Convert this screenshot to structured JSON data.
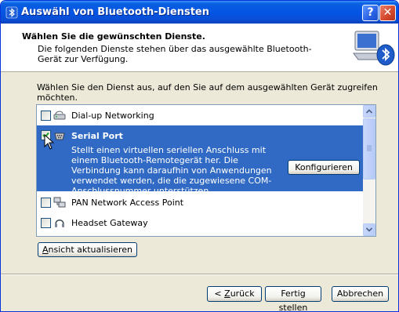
{
  "window": {
    "title": "Auswähl von Bluetooth-Diensten",
    "help_glyph": "?",
    "close_glyph": "✕"
  },
  "header": {
    "title": "Wählen Sie die gewünschten Dienste.",
    "subtitle": "Die folgenden Dienste stehen über das ausgewählte Bluetooth-Gerät zur Verfügung."
  },
  "instruction": "Wählen Sie den Dienst aus, auf den Sie auf dem ausgewählten Gerät zugreifen möchten.",
  "services": [
    {
      "label": "Dial-up Networking",
      "checked": false,
      "icon": "modem-icon"
    },
    {
      "label": "Serial Port",
      "checked": true,
      "icon": "serial-port-icon",
      "description": "Stellt einen virtuellen seriellen Anschluss mit einem Bluetooth-Remotegerät her. Die Verbindung kann daraufhin von Anwendungen verwendet werden, die die zugewiesene COM-Anschlussnummer unterstützen.",
      "configure_label": "Konfigurieren"
    },
    {
      "label": "PAN Network Access Point",
      "checked": false,
      "icon": "network-icon"
    },
    {
      "label": "Headset Gateway",
      "checked": false,
      "icon": "headset-icon"
    }
  ],
  "buttons": {
    "refresh_accel": "A",
    "refresh_rest": "nsicht aktualisieren",
    "back_prefix": "< ",
    "back_accel": "Z",
    "back_rest": "urück",
    "finish": "Fertig stellen",
    "cancel": "Abbrechen"
  },
  "colors": {
    "title_bar": "#0454e3",
    "selection": "#316ac5",
    "dialog_face": "#ece9d8"
  }
}
